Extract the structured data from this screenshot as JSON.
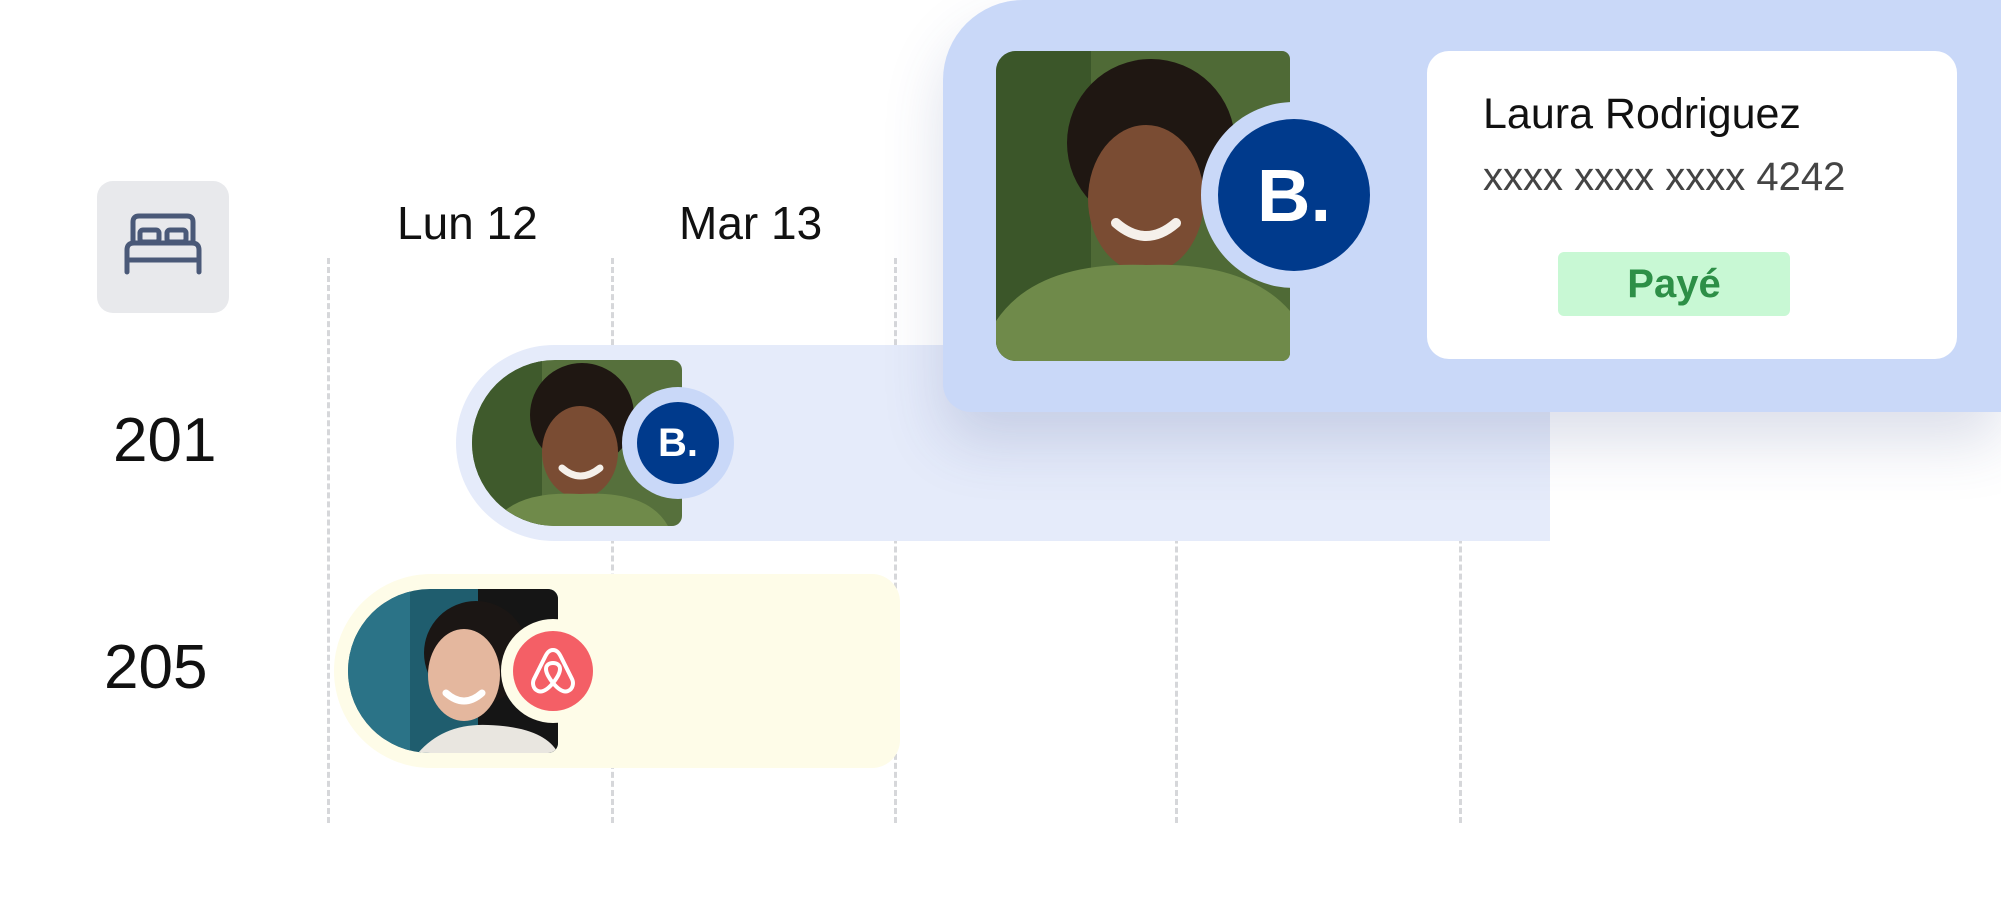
{
  "calendar": {
    "days": [
      {
        "label": "Lun 12"
      },
      {
        "label": "Mar 13"
      }
    ],
    "rooms": [
      {
        "number": "201"
      },
      {
        "number": "205"
      }
    ]
  },
  "bookings": [
    {
      "room": "201",
      "channel": "booking-com",
      "channel_badge": "B."
    },
    {
      "room": "205",
      "channel": "airbnb"
    }
  ],
  "detail_popup": {
    "guest_name": "Laura Rodriguez",
    "card_number": "xxxx xxxx xxxx 4242",
    "payment_status": "Payé",
    "channel_badge": "B."
  },
  "icons": {
    "room_type": "bed-icon",
    "booking_channel": "booking-com-logo",
    "airbnb_channel": "airbnb-logo-icon"
  },
  "colors": {
    "booking_blue": "#003a8c",
    "popup_background": "#c9d8f8",
    "bar_201": "#e5ebfa",
    "bar_205": "#fefce8",
    "paid_background": "#c8f8d4",
    "paid_text": "#2d8f47",
    "airbnb_red": "#f45f66"
  }
}
